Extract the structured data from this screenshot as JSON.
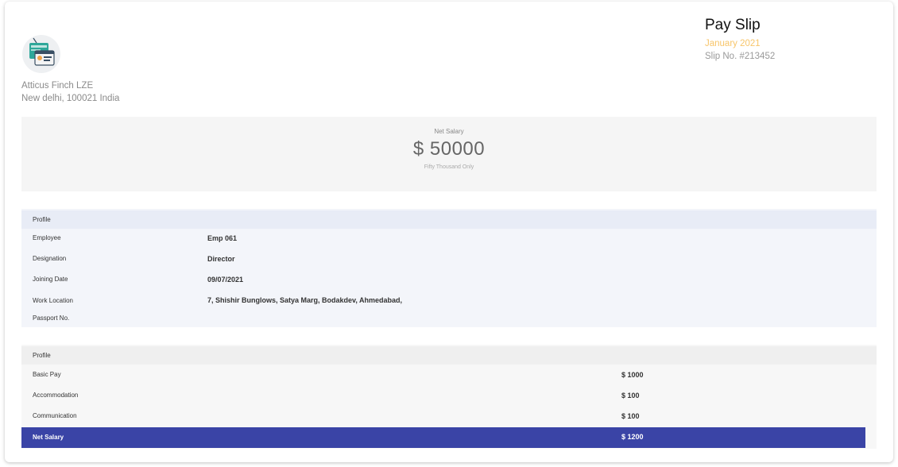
{
  "company": {
    "name": "Atticus Finch LZE",
    "address": "New delhi, 100021 India"
  },
  "header": {
    "title": "Pay Slip",
    "period": "January 2021",
    "slip_no": "Slip No. #213452"
  },
  "net_salary": {
    "label": "Net Salary",
    "amount": "$ 50000",
    "words": "Fifty Thousand Only"
  },
  "profile": {
    "heading": "Profile",
    "rows": [
      {
        "label": "Employee",
        "value": "Emp 061"
      },
      {
        "label": "Designation",
        "value": "Director"
      },
      {
        "label": "Joining Date",
        "value": "09/07/2021"
      },
      {
        "label": "Work Location",
        "value": "7, Shishir Bunglows, Satya Marg, Bodakdev, Ahmedabad,"
      },
      {
        "label": "Passport No.",
        "value": ""
      }
    ]
  },
  "earnings": {
    "heading": "Profile",
    "rows": [
      {
        "label": "Basic Pay",
        "value": "$ 1000"
      },
      {
        "label": "Accommodation",
        "value": "$ 100"
      },
      {
        "label": "Communication",
        "value": "$ 100"
      }
    ],
    "total": {
      "label": "Net Salary",
      "value": "$ 1200"
    }
  },
  "colors": {
    "accent": "#3a44a6",
    "period": "#f7c56a"
  },
  "icons": {
    "logo": "payslip-logo-icon"
  }
}
